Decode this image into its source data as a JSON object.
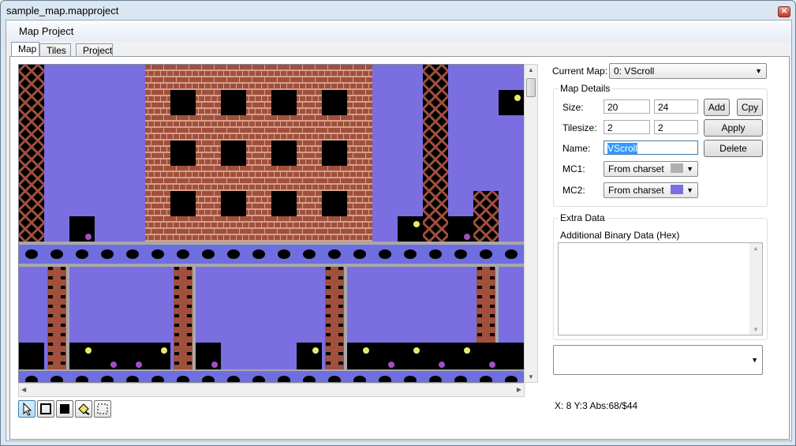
{
  "window": {
    "title": "sample_map.mapproject",
    "close_glyph": "✕"
  },
  "menu": {
    "items": [
      {
        "label": "Map Project",
        "accel": "M"
      }
    ]
  },
  "tabs": [
    {
      "label": "Map",
      "active": true
    },
    {
      "label": "Tiles",
      "active": false
    },
    {
      "label": "Project",
      "active": false
    }
  ],
  "current_map": {
    "label": "Current Map:",
    "value": "0: VScroll"
  },
  "map_details": {
    "title": "Map Details",
    "size": {
      "label": "Size:",
      "width": "20",
      "height": "24"
    },
    "tilesize": {
      "label": "Tilesize:",
      "width": "2",
      "height": "2"
    },
    "name": {
      "label": "Name:",
      "value": "VScroll"
    },
    "mc1": {
      "label": "MC1:",
      "value": "From charset",
      "color": "#b0b0b0"
    },
    "mc2": {
      "label": "MC2:",
      "value": "From charset",
      "color": "#7b6ee0"
    },
    "buttons": {
      "add": "Add",
      "copy": "Cpy",
      "apply": "Apply",
      "delete": "Delete"
    }
  },
  "extra_data": {
    "title": "Extra Data",
    "binary_label": "Additional Binary Data (Hex)",
    "binary_value": ""
  },
  "status": {
    "coords": "X: 8 Y:3 Abs:68/$44"
  },
  "tools": [
    {
      "name": "select-tool-icon",
      "selected": true
    },
    {
      "name": "rectangle-tool-icon",
      "selected": false
    },
    {
      "name": "filled-rectangle-tool-icon",
      "selected": false
    },
    {
      "name": "fill-tool-icon",
      "selected": false
    },
    {
      "name": "selection-tool-icon",
      "selected": false
    }
  ],
  "colors": {
    "sky": "#7b6ee0",
    "brick": "#a0503c",
    "mortar": "#d8a08c",
    "girder": "#6e6ee0",
    "grey": "#a8a8a8"
  }
}
